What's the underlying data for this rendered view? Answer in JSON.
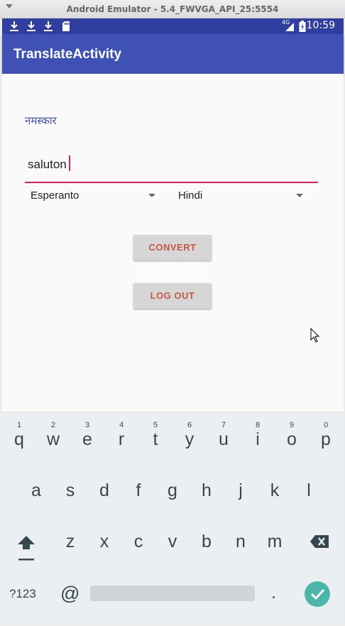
{
  "window": {
    "title": "Android Emulator - 5.4_FWVGA_API_25:5554"
  },
  "statusbar": {
    "time": "10:59",
    "network": "4G",
    "left_icons": [
      "download-icon",
      "download-icon",
      "download-icon",
      "sd-card-icon"
    ],
    "right_icons": [
      "signal-icon",
      "battery-charging-icon"
    ]
  },
  "appbar": {
    "title": "TranslateActivity"
  },
  "main": {
    "result_text": "नमस्कार",
    "input": {
      "value": "saluton"
    },
    "source_language": "Esperanto",
    "target_language": "Hindi",
    "convert_label": "CONVERT",
    "logout_label": "LOG OUT"
  },
  "keyboard": {
    "row1": [
      {
        "hint": "1",
        "key": "q"
      },
      {
        "hint": "2",
        "key": "w"
      },
      {
        "hint": "3",
        "key": "e"
      },
      {
        "hint": "4",
        "key": "r"
      },
      {
        "hint": "5",
        "key": "t"
      },
      {
        "hint": "6",
        "key": "y"
      },
      {
        "hint": "7",
        "key": "u"
      },
      {
        "hint": "8",
        "key": "i"
      },
      {
        "hint": "9",
        "key": "o"
      },
      {
        "hint": "0",
        "key": "p"
      }
    ],
    "row2": [
      "a",
      "s",
      "d",
      "f",
      "g",
      "h",
      "j",
      "k",
      "l"
    ],
    "row3": [
      "z",
      "x",
      "c",
      "v",
      "b",
      "n",
      "m"
    ],
    "symbols_label": "?123",
    "at_label": "@",
    "period_label": ".",
    "icons": [
      "shift-icon",
      "backspace-icon",
      "enter-check-icon"
    ]
  },
  "colors": {
    "primary": "#3F51B5",
    "primary_dark": "#303F9F",
    "accent": "#E91E63",
    "button_text": "#c9573f",
    "keyboard_enter": "#4db6ac"
  }
}
